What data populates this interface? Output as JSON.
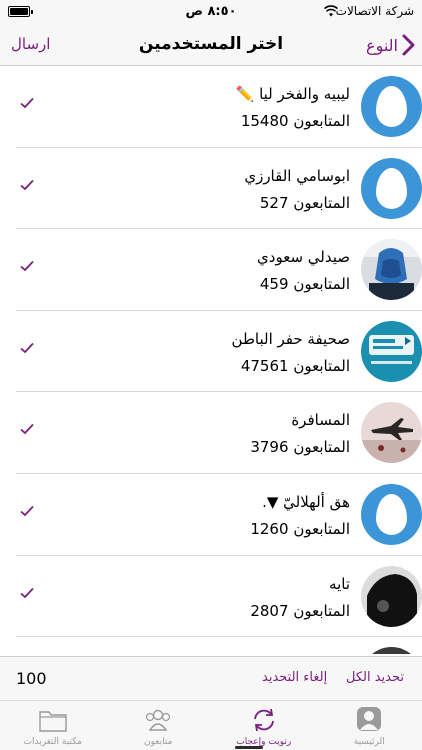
{
  "status_bar": {
    "carrier": "شركة الاتصالات",
    "time": "٨:٥٠ ص"
  },
  "nav": {
    "title": "اختر المستخدمين",
    "send_label": "ارسال",
    "back_label": "النوع"
  },
  "users": [
    {
      "name": "ليبيه والفخر ليا ✏️",
      "followers_label": "المتابعون",
      "followers": "15480",
      "avatar": "default-egg"
    },
    {
      "name": "ابوسامي القارزي",
      "followers_label": "المتابعون",
      "followers": "527",
      "avatar": "default-egg"
    },
    {
      "name": "صيدلي سعودي",
      "followers_label": "المتابعون",
      "followers": "459",
      "avatar": "photo-blue-scarf"
    },
    {
      "name": "صحيفة حفر الباطن",
      "followers_label": "المتابعون",
      "followers": "47561",
      "avatar": "logo-hafr-albatin"
    },
    {
      "name": "المسافرة",
      "followers_label": "المتابعون",
      "followers": "3796",
      "avatar": "photo-airplane"
    },
    {
      "name": "هق ألهلاليّ ▼.",
      "followers_label": "المتابعون",
      "followers": "1260",
      "avatar": "default-egg"
    },
    {
      "name": "تايه",
      "followers_label": "المتابعون",
      "followers": "2807",
      "avatar": "photo-dark-silhouette"
    }
  ],
  "selection_bar": {
    "count": "100",
    "cancel_label": "إلغاء التحديد",
    "select_all_label": "تحديد الكل"
  },
  "tabs": [
    {
      "label": "الرئيسية",
      "icon": "profile-icon",
      "active": false
    },
    {
      "label": "رتويت وإعجاب",
      "icon": "retweet-icon",
      "active": true
    },
    {
      "label": "متابعون",
      "icon": "followers-icon",
      "active": false
    },
    {
      "label": "مكتبة التغريدات",
      "icon": "folder-icon",
      "active": false
    }
  ],
  "colors": {
    "accent": "#7b1f7e",
    "egg_avatar": "#3b95d6",
    "inactive_tab": "#9a9a9a"
  }
}
